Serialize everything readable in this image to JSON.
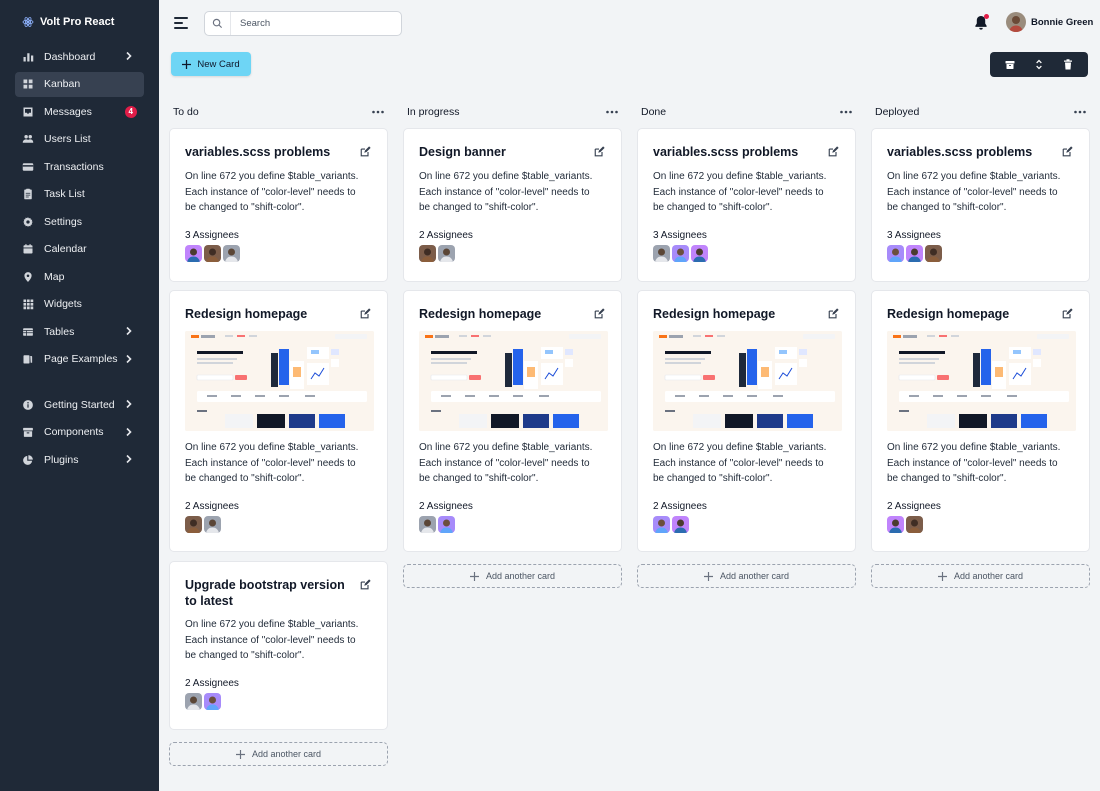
{
  "sidebar": {
    "brand": "Volt Pro React",
    "items": [
      {
        "label": "Dashboard",
        "icon": "chart-bar-icon",
        "chevron": true
      },
      {
        "label": "Kanban",
        "icon": "view-grid-icon",
        "active": true
      },
      {
        "label": "Messages",
        "icon": "inbox-icon",
        "badge": "4"
      },
      {
        "label": "Users List",
        "icon": "users-icon"
      },
      {
        "label": "Transactions",
        "icon": "credit-card-icon"
      },
      {
        "label": "Task List",
        "icon": "clipboard-list-icon"
      },
      {
        "label": "Settings",
        "icon": "cog-icon"
      },
      {
        "label": "Calendar",
        "icon": "calendar-icon"
      },
      {
        "label": "Map",
        "icon": "location-marker-icon"
      },
      {
        "label": "Widgets",
        "icon": "widgets-grid-icon"
      },
      {
        "label": "Tables",
        "icon": "table-icon",
        "chevron": true
      },
      {
        "label": "Page Examples",
        "icon": "document-duplicate-icon",
        "chevron": true
      },
      {
        "label": "Getting Started",
        "icon": "info-circle-icon",
        "chevron": true
      },
      {
        "label": "Components",
        "icon": "archive-icon",
        "chevron": true
      },
      {
        "label": "Plugins",
        "icon": "chart-pie-icon",
        "chevron": true
      }
    ]
  },
  "topbar": {
    "search_placeholder": "Search",
    "user_name": "Bonnie Green"
  },
  "actions": {
    "new_card": "New Card",
    "toolbar": [
      "archive-icon",
      "selector-icon",
      "trash-icon"
    ]
  },
  "colors": {
    "sidebar_bg": "#1f2937",
    "page_bg": "#f2f4f6",
    "accent": "#6ed5f5",
    "badge": "#e11d48"
  },
  "add_card_label": "Add another card",
  "columns": [
    {
      "title": "To do",
      "cards": [
        {
          "title": "variables.scss problems",
          "desc": [
            "On line 672 you define $table_variants.",
            "Each instance of \"color-level\" needs to",
            "be changed to \"shift-color\"."
          ],
          "assignees": "3 Assignees",
          "avatar_count": 3
        },
        {
          "title": "Redesign homepage",
          "image": true,
          "desc": [
            "On line 672 you define $table_variants.",
            "Each instance of \"color-level\" needs to",
            "be changed to \"shift-color\"."
          ],
          "assignees": "2 Assignees",
          "avatar_count": 2
        },
        {
          "title": "Upgrade bootstrap version to latest",
          "desc": [
            "On line 672 you define $table_variants.",
            "Each instance of \"color-level\" needs to",
            "be changed to \"shift-color\"."
          ],
          "assignees": "2 Assignees",
          "avatar_count": 2
        }
      ]
    },
    {
      "title": "In progress",
      "cards": [
        {
          "title": "Design banner",
          "desc": [
            "On line 672 you define $table_variants.",
            "Each instance of \"color-level\" needs to",
            "be changed to \"shift-color\"."
          ],
          "assignees": "2 Assignees",
          "avatar_count": 2
        },
        {
          "title": "Redesign homepage",
          "image": true,
          "desc": [
            "On line 672 you define $table_variants.",
            "Each instance of \"color-level\" needs to",
            "be changed to \"shift-color\"."
          ],
          "assignees": "2 Assignees",
          "avatar_count": 2
        }
      ]
    },
    {
      "title": "Done",
      "cards": [
        {
          "title": "variables.scss problems",
          "desc": [
            "On line 672 you define $table_variants.",
            "Each instance of \"color-level\" needs to",
            "be changed to \"shift-color\"."
          ],
          "assignees": "3 Assignees",
          "avatar_count": 3
        },
        {
          "title": "Redesign homepage",
          "image": true,
          "desc": [
            "On line 672 you define $table_variants.",
            "Each instance of \"color-level\" needs to",
            "be changed to \"shift-color\"."
          ],
          "assignees": "2 Assignees",
          "avatar_count": 2
        }
      ]
    },
    {
      "title": "Deployed",
      "cards": [
        {
          "title": "variables.scss problems",
          "desc": [
            "On line 672 you define $table_variants.",
            "Each instance of \"color-level\" needs to",
            "be changed to \"shift-color\"."
          ],
          "assignees": "3 Assignees",
          "avatar_count": 3
        },
        {
          "title": "Redesign homepage",
          "image": true,
          "desc": [
            "On line 672 you define $table_variants.",
            "Each instance of \"color-level\" needs to",
            "be changed to \"shift-color\"."
          ],
          "assignees": "2 Assignees",
          "avatar_count": 2
        }
      ]
    }
  ]
}
